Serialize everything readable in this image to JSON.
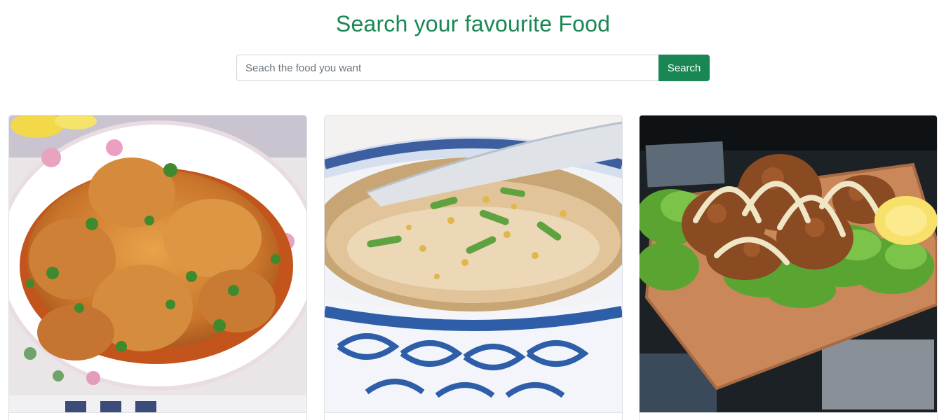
{
  "page": {
    "title": "Search your favourite Food"
  },
  "search": {
    "placeholder": "Seach the food you want",
    "value": "",
    "button_label": "Search"
  },
  "colors": {
    "brand": "#198754",
    "border": "#ced4da"
  },
  "cards": [
    {
      "image": "chicken-curry-bowl"
    },
    {
      "image": "rice-porridge-blue-bowl"
    },
    {
      "image": "fried-chicken-on-lettuce-board"
    }
  ]
}
